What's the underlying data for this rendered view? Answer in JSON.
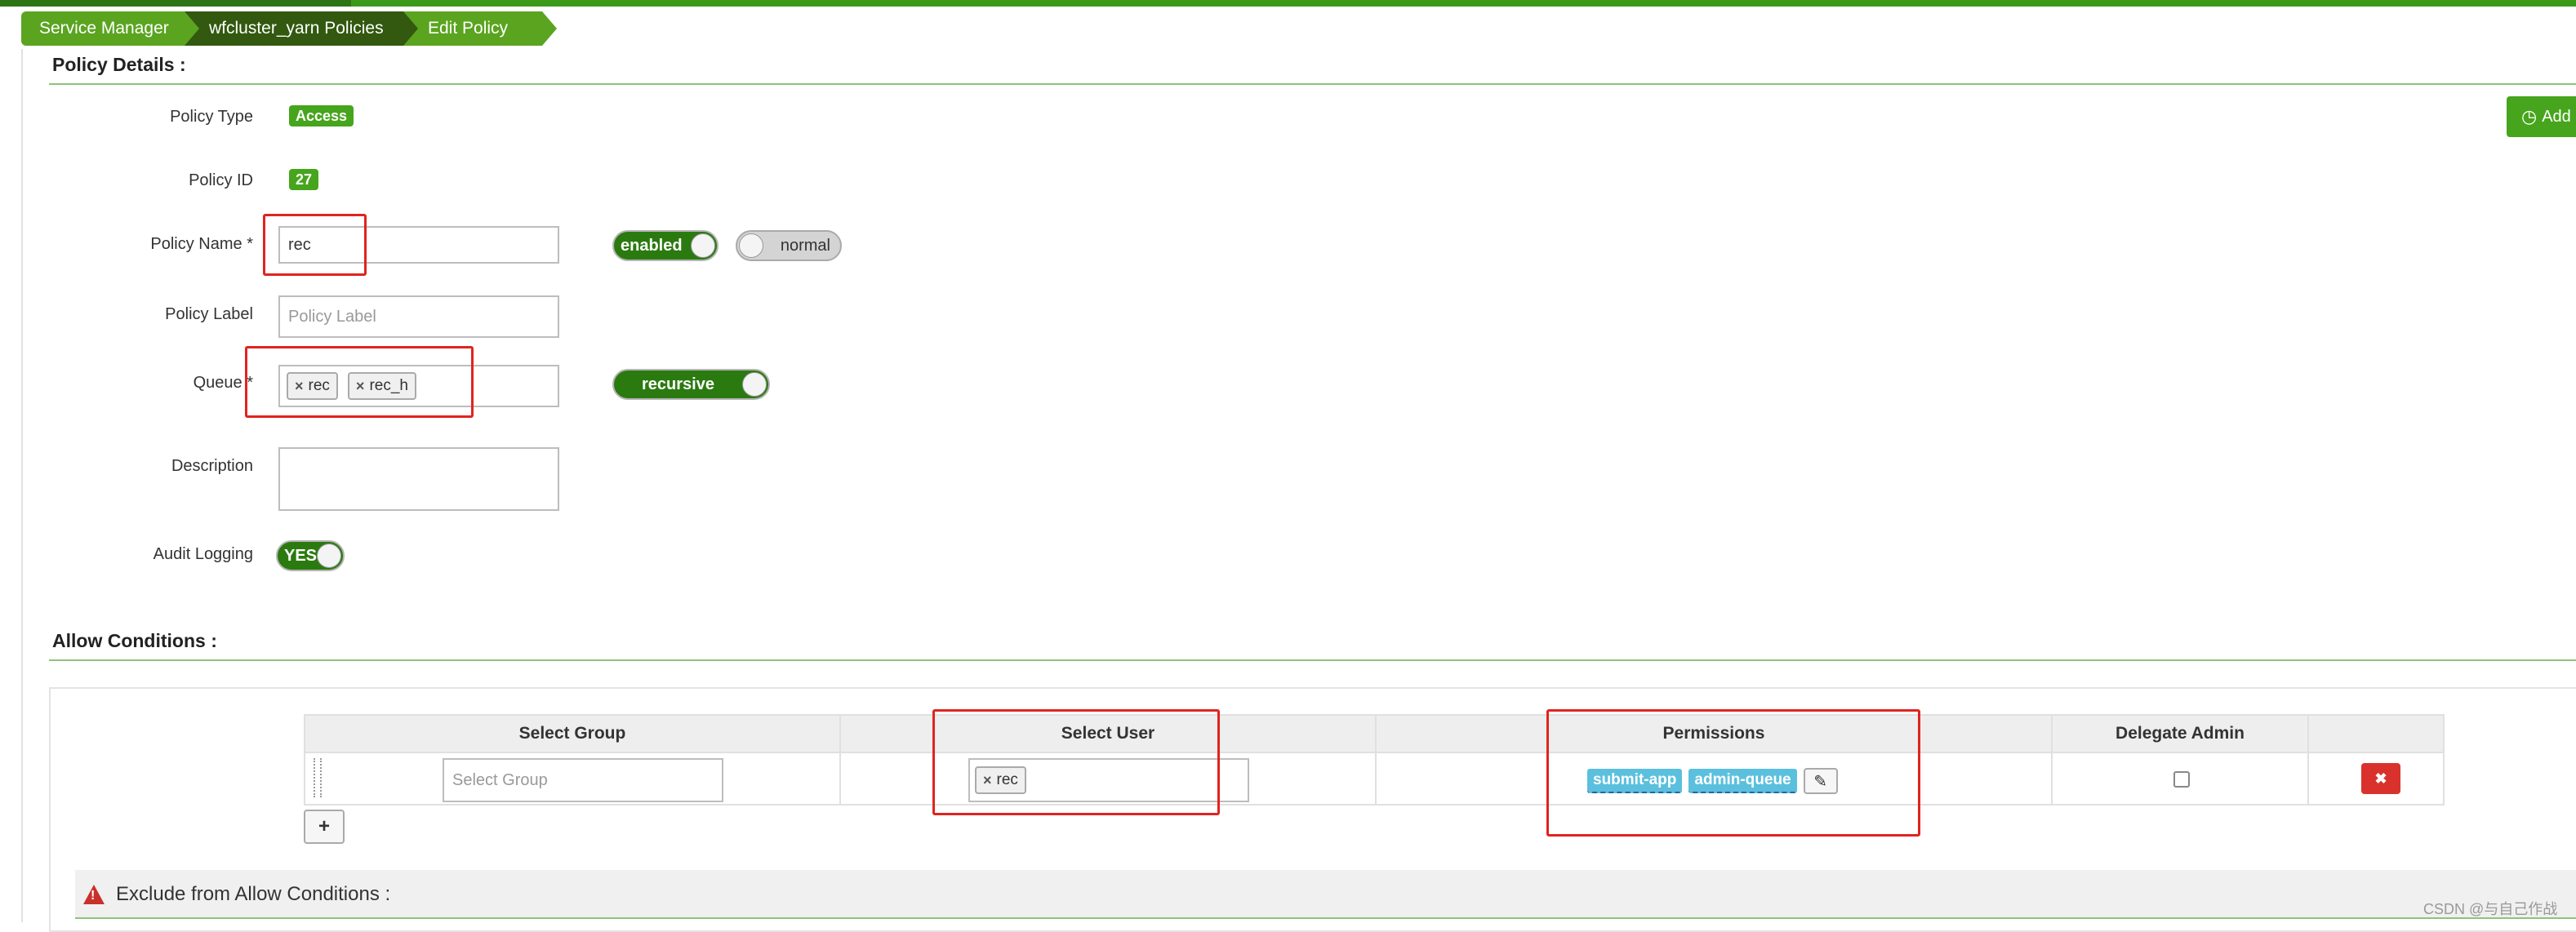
{
  "breadcrumb": {
    "items": [
      "Service Manager",
      "wfcluster_yarn Policies",
      "Edit Policy"
    ]
  },
  "policy_details": {
    "title": "Policy Details :",
    "policy_type_label": "Policy Type",
    "policy_type_value": "Access",
    "policy_id_label": "Policy ID",
    "policy_id_value": "27",
    "policy_name_label": "Policy Name *",
    "policy_name_value": "rec",
    "enabled_toggle": "enabled",
    "normal_toggle": "normal",
    "policy_label_label": "Policy Label",
    "policy_label_placeholder": "Policy Label",
    "queue_label": "Queue *",
    "queue_tags": [
      "rec",
      "rec_h"
    ],
    "recursive_toggle": "recursive",
    "description_label": "Description",
    "audit_logging_label": "Audit Logging",
    "audit_logging_value": "YES",
    "add_button_label": "Add"
  },
  "allow_conditions": {
    "title": "Allow Conditions :",
    "headers": [
      "Select Group",
      "Select User",
      "Permissions",
      "Delegate Admin"
    ],
    "group_placeholder": "Select Group",
    "user_tags": [
      "rec"
    ],
    "permissions": [
      "submit-app",
      "admin-queue"
    ],
    "add_row_label": "+"
  },
  "exclude": {
    "title": "Exclude from Allow Conditions :"
  },
  "watermark": "CSDN @与自己作战",
  "colors": {
    "brand_green": "#46a51c",
    "dark_green": "#32590f",
    "highlight_red": "#e0241f",
    "permission_blue": "#5bc0de",
    "danger_red": "#d9322d"
  }
}
